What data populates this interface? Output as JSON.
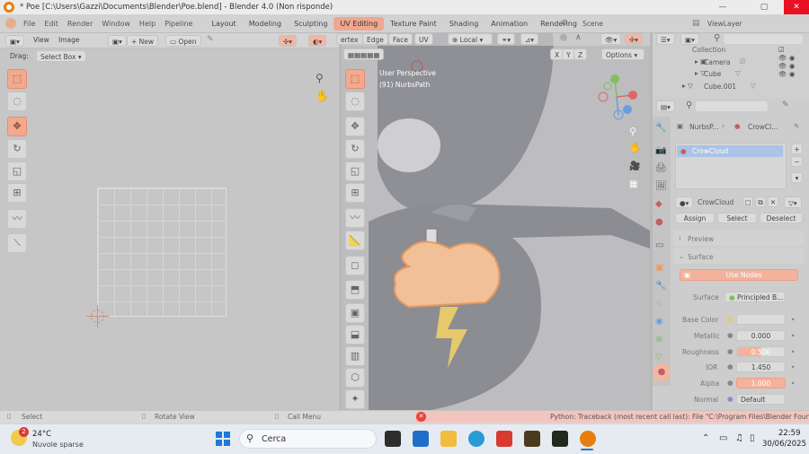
{
  "window": {
    "title": "* Poe [C:\\Users\\Gazzi\\Documents\\Blender\\Poe.blend] - Blender 4.0 (Non risponde)",
    "controls": [
      "—",
      "▢",
      "✕"
    ]
  },
  "menu": [
    "File",
    "Edit",
    "Render",
    "Window",
    "Help",
    "Pipeline"
  ],
  "workspaces": [
    "Layout",
    "Modeling",
    "Sculpting",
    "UV Editing",
    "Texture Paint",
    "Shading",
    "Animation",
    "Rendering"
  ],
  "active_workspace": "UV Editing",
  "scene": {
    "name": "Scene",
    "view_layer": "ViewLayer"
  },
  "uv_editor": {
    "header": {
      "view": "View",
      "image": "Image",
      "new": "New",
      "open": "Open"
    },
    "drag_label": "Drag:",
    "drag_value": "Select Box"
  },
  "viewport": {
    "select_modes": [
      "Vertex",
      "Edge",
      "Face",
      "UV"
    ],
    "vertex_trunc": "ertex",
    "transform_orientation": "Local",
    "axes": [
      "X",
      "Y",
      "Z"
    ],
    "options": "Options",
    "info_line1": "User Perspective",
    "info_line2": "(91) NurbsPath"
  },
  "outliner": {
    "items": [
      {
        "name": "Collection"
      },
      {
        "name": "Camera"
      },
      {
        "name": "Cube"
      },
      {
        "name": "Cube.001"
      }
    ]
  },
  "properties": {
    "breadcrumb_object": "NurbsP...",
    "breadcrumb_material": "CrowCl...",
    "material_slot": "CrowCloud",
    "material_name": "CrowCloud",
    "assign": "Assign",
    "select": "Select",
    "deselect": "Deselect",
    "preview": "Preview",
    "surface": "Surface",
    "use_nodes": "Use Nodes",
    "surface_label": "Surface",
    "surface_value": "Principled B...",
    "rows": [
      {
        "label": "Base Color",
        "value": ""
      },
      {
        "label": "Metallic",
        "value": "0.000"
      },
      {
        "label": "Roughness",
        "value": "0.500"
      },
      {
        "label": "IOR",
        "value": "1.450"
      },
      {
        "label": "Alpha",
        "value": "1.000"
      },
      {
        "label": "Normal",
        "value": "Default"
      }
    ]
  },
  "statusbar": {
    "select": "Select",
    "rotate": "Rotate View",
    "call_menu": "Call Menu",
    "error": "Python: Traceback (most recent call last):  File \"C:\\Program Files\\Blender Foun"
  },
  "taskbar": {
    "weather_badge": "2",
    "temperature": "24°C",
    "weather_desc": "Nuvole sparse",
    "search": "Cerca",
    "time": "22:59",
    "date": "30/06/2025"
  },
  "colors": {
    "accent": "#efa78f",
    "selection": "#f2a98e",
    "error": "#e8443a",
    "taskbar": "#e6ebf1"
  }
}
